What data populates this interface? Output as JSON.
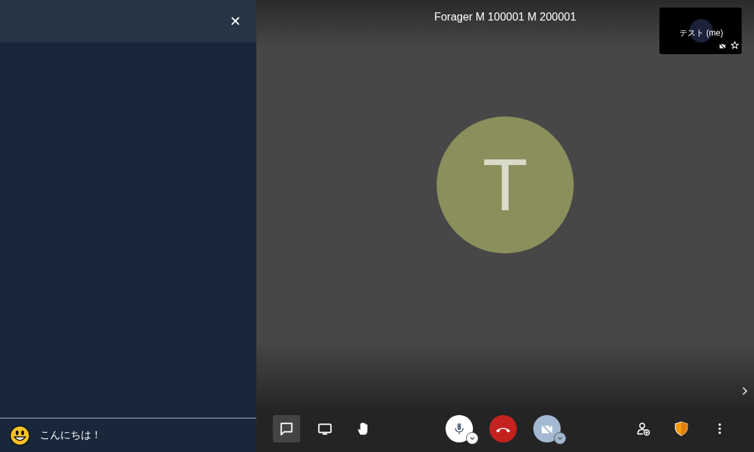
{
  "chat_panel": {
    "close_label": "✕",
    "message": {
      "value": "こんにちは！"
    }
  },
  "conference": {
    "title": "Forager M 100001 M 200001",
    "avatar_letter": "T"
  },
  "local_thumbnail": {
    "label": "テスト (me)",
    "video_muted": true
  },
  "toolbar": {
    "left": [
      {
        "kind": "chat",
        "selected": true
      },
      {
        "kind": "screen",
        "selected": false
      },
      {
        "kind": "hand",
        "selected": false
      }
    ],
    "microphone": {
      "muted": false
    },
    "camera": {
      "muted": true
    },
    "right": [
      {
        "kind": "invite"
      },
      {
        "kind": "security"
      },
      {
        "kind": "more"
      }
    ]
  }
}
